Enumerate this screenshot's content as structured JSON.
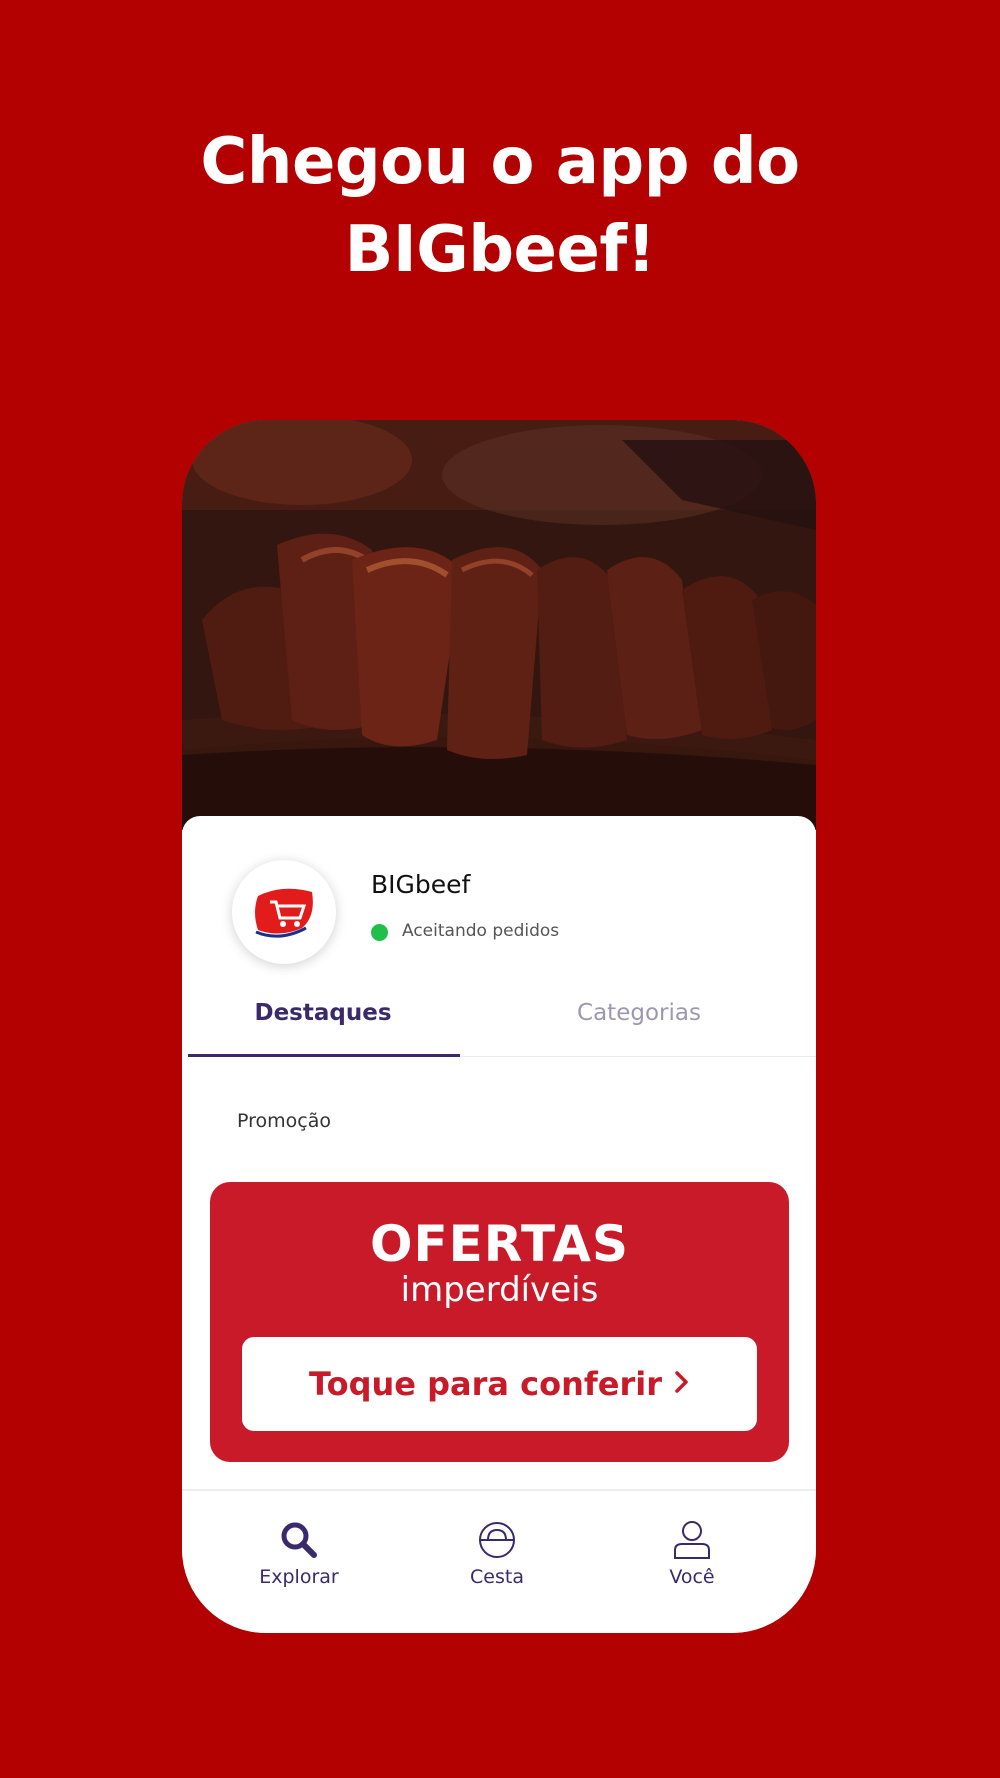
{
  "headline": {
    "line1": "Chegou o app do",
    "line2": "BIGbeef!"
  },
  "store": {
    "name": "BIGbeef",
    "status": "Aceitando pedidos"
  },
  "tabs": [
    {
      "label": "Destaques",
      "active": true
    },
    {
      "label": "Categorias",
      "active": false
    }
  ],
  "section": {
    "label": "Promoção"
  },
  "promo": {
    "title": "OFERTAS",
    "subtitle": "imperdíveis",
    "cta": "Toque para conferir",
    "cta_icon": "chevron-right-icon"
  },
  "nav": [
    {
      "label": "Explorar",
      "icon": "search-icon"
    },
    {
      "label": "Cesta",
      "icon": "basket-icon"
    },
    {
      "label": "Você",
      "icon": "user-icon"
    }
  ],
  "colors": {
    "background": "#b30000",
    "promo": "#c81a28",
    "accent": "#3a2a6b",
    "status_online": "#1fbf4a"
  }
}
